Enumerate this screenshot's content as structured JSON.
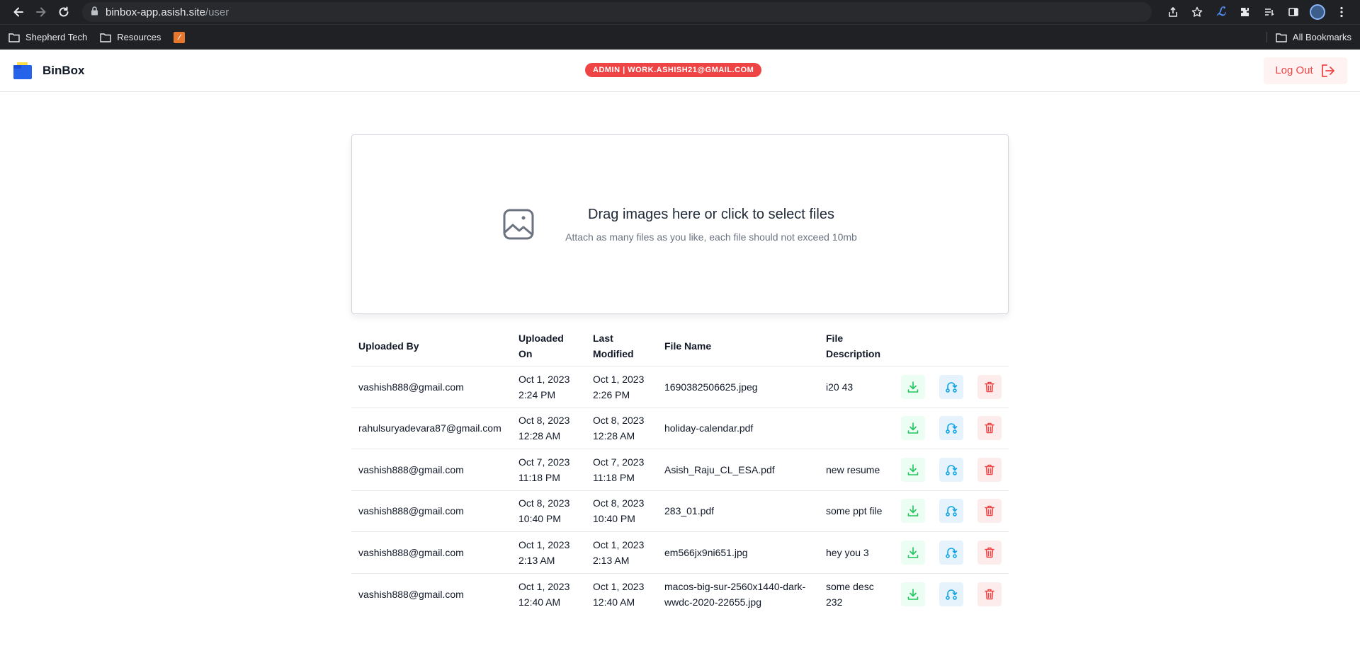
{
  "browser": {
    "url_host": "binbox-app.asish.site",
    "url_path": "/user",
    "bookmarks": [
      {
        "label": "Shepherd Tech",
        "icon": "folder-icon"
      },
      {
        "label": "Resources",
        "icon": "folder-icon"
      },
      {
        "label": "",
        "icon": "favicon-icon"
      }
    ],
    "all_bookmarks": "All Bookmarks"
  },
  "header": {
    "brand": "BinBox",
    "badge": "ADMIN | WORK.ASHISH21@GMAIL.COM",
    "logout": "Log Out"
  },
  "dropzone": {
    "title": "Drag images here or click to select files",
    "subtitle": "Attach as many files as you like, each file should not exceed 10mb"
  },
  "table": {
    "headers": {
      "uploaded_by": "Uploaded By",
      "uploaded_on": "Uploaded On",
      "last_modified": "Last Modified",
      "file_name": "File Name",
      "file_description": "File Description"
    },
    "rows": [
      {
        "uploaded_by": "vashish888@gmail.com",
        "uploaded_on_date": "Oct 1, 2023",
        "uploaded_on_time": "2:24 PM",
        "modified_date": "Oct 1, 2023",
        "modified_time": "2:26 PM",
        "file_name": "1690382506625.jpeg",
        "description": "i20 43"
      },
      {
        "uploaded_by": "rahulsuryadevara87@gmail.com",
        "uploaded_on_date": "Oct 8, 2023",
        "uploaded_on_time": "12:28 AM",
        "modified_date": "Oct 8, 2023",
        "modified_time": "12:28 AM",
        "file_name": "holiday-calendar.pdf",
        "description": ""
      },
      {
        "uploaded_by": "vashish888@gmail.com",
        "uploaded_on_date": "Oct 7, 2023",
        "uploaded_on_time": "11:18 PM",
        "modified_date": "Oct 7, 2023",
        "modified_time": "11:18 PM",
        "file_name": "Asish_Raju_CL_ESA.pdf",
        "description": "new resume"
      },
      {
        "uploaded_by": "vashish888@gmail.com",
        "uploaded_on_date": "Oct 8, 2023",
        "uploaded_on_time": "10:40 PM",
        "modified_date": "Oct 8, 2023",
        "modified_time": "10:40 PM",
        "file_name": "283_01.pdf",
        "description": "some ppt file"
      },
      {
        "uploaded_by": "vashish888@gmail.com",
        "uploaded_on_date": "Oct 1, 2023",
        "uploaded_on_time": "2:13 AM",
        "modified_date": "Oct 1, 2023",
        "modified_time": "2:13 AM",
        "file_name": "em566jx9ni651.jpg",
        "description": "hey you 3"
      },
      {
        "uploaded_by": "vashish888@gmail.com",
        "uploaded_on_date": "Oct 1, 2023",
        "uploaded_on_time": "12:40 AM",
        "modified_date": "Oct 1, 2023",
        "modified_time": "12:40 AM",
        "file_name": "macos-big-sur-2560x1440-dark-wwdc-2020-22655.jpg",
        "description": "some desc 232"
      }
    ]
  },
  "colors": {
    "badge_bg": "#ef4444",
    "download_accent": "#22c55e",
    "rename_accent": "#0ea5e9",
    "delete_accent": "#ef4444"
  }
}
